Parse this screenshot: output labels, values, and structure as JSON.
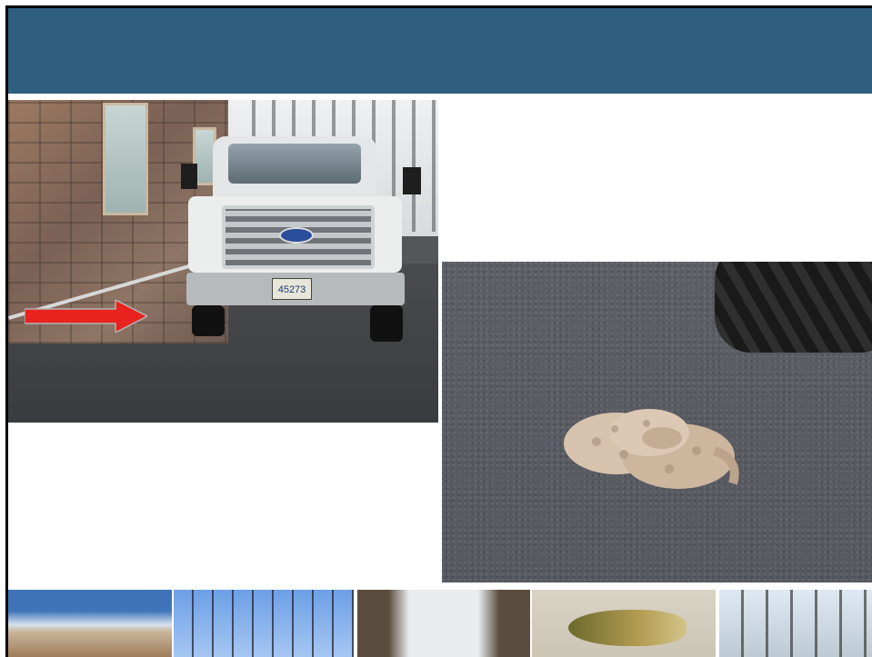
{
  "slide": {
    "header_title": "",
    "truck_photo": {
      "plate_text": "45273",
      "colors": {
        "arrow": "#e8231f",
        "truck": "#eceeee"
      }
    },
    "snake_photo": {
      "colors": {
        "snake": "#d7c2ad",
        "asphalt": "#5a5c63"
      }
    },
    "footer_thumbnails": [
      {
        "icon": "desert-landscape-thumbnail"
      },
      {
        "icon": "power-lines-thumbnail"
      },
      {
        "icon": "dam-thumbnail"
      },
      {
        "icon": "fish-thumbnail"
      },
      {
        "icon": "substation-thumbnail"
      }
    ],
    "colors": {
      "header_bar": "#2e5f80",
      "background": "#ffffff"
    }
  }
}
